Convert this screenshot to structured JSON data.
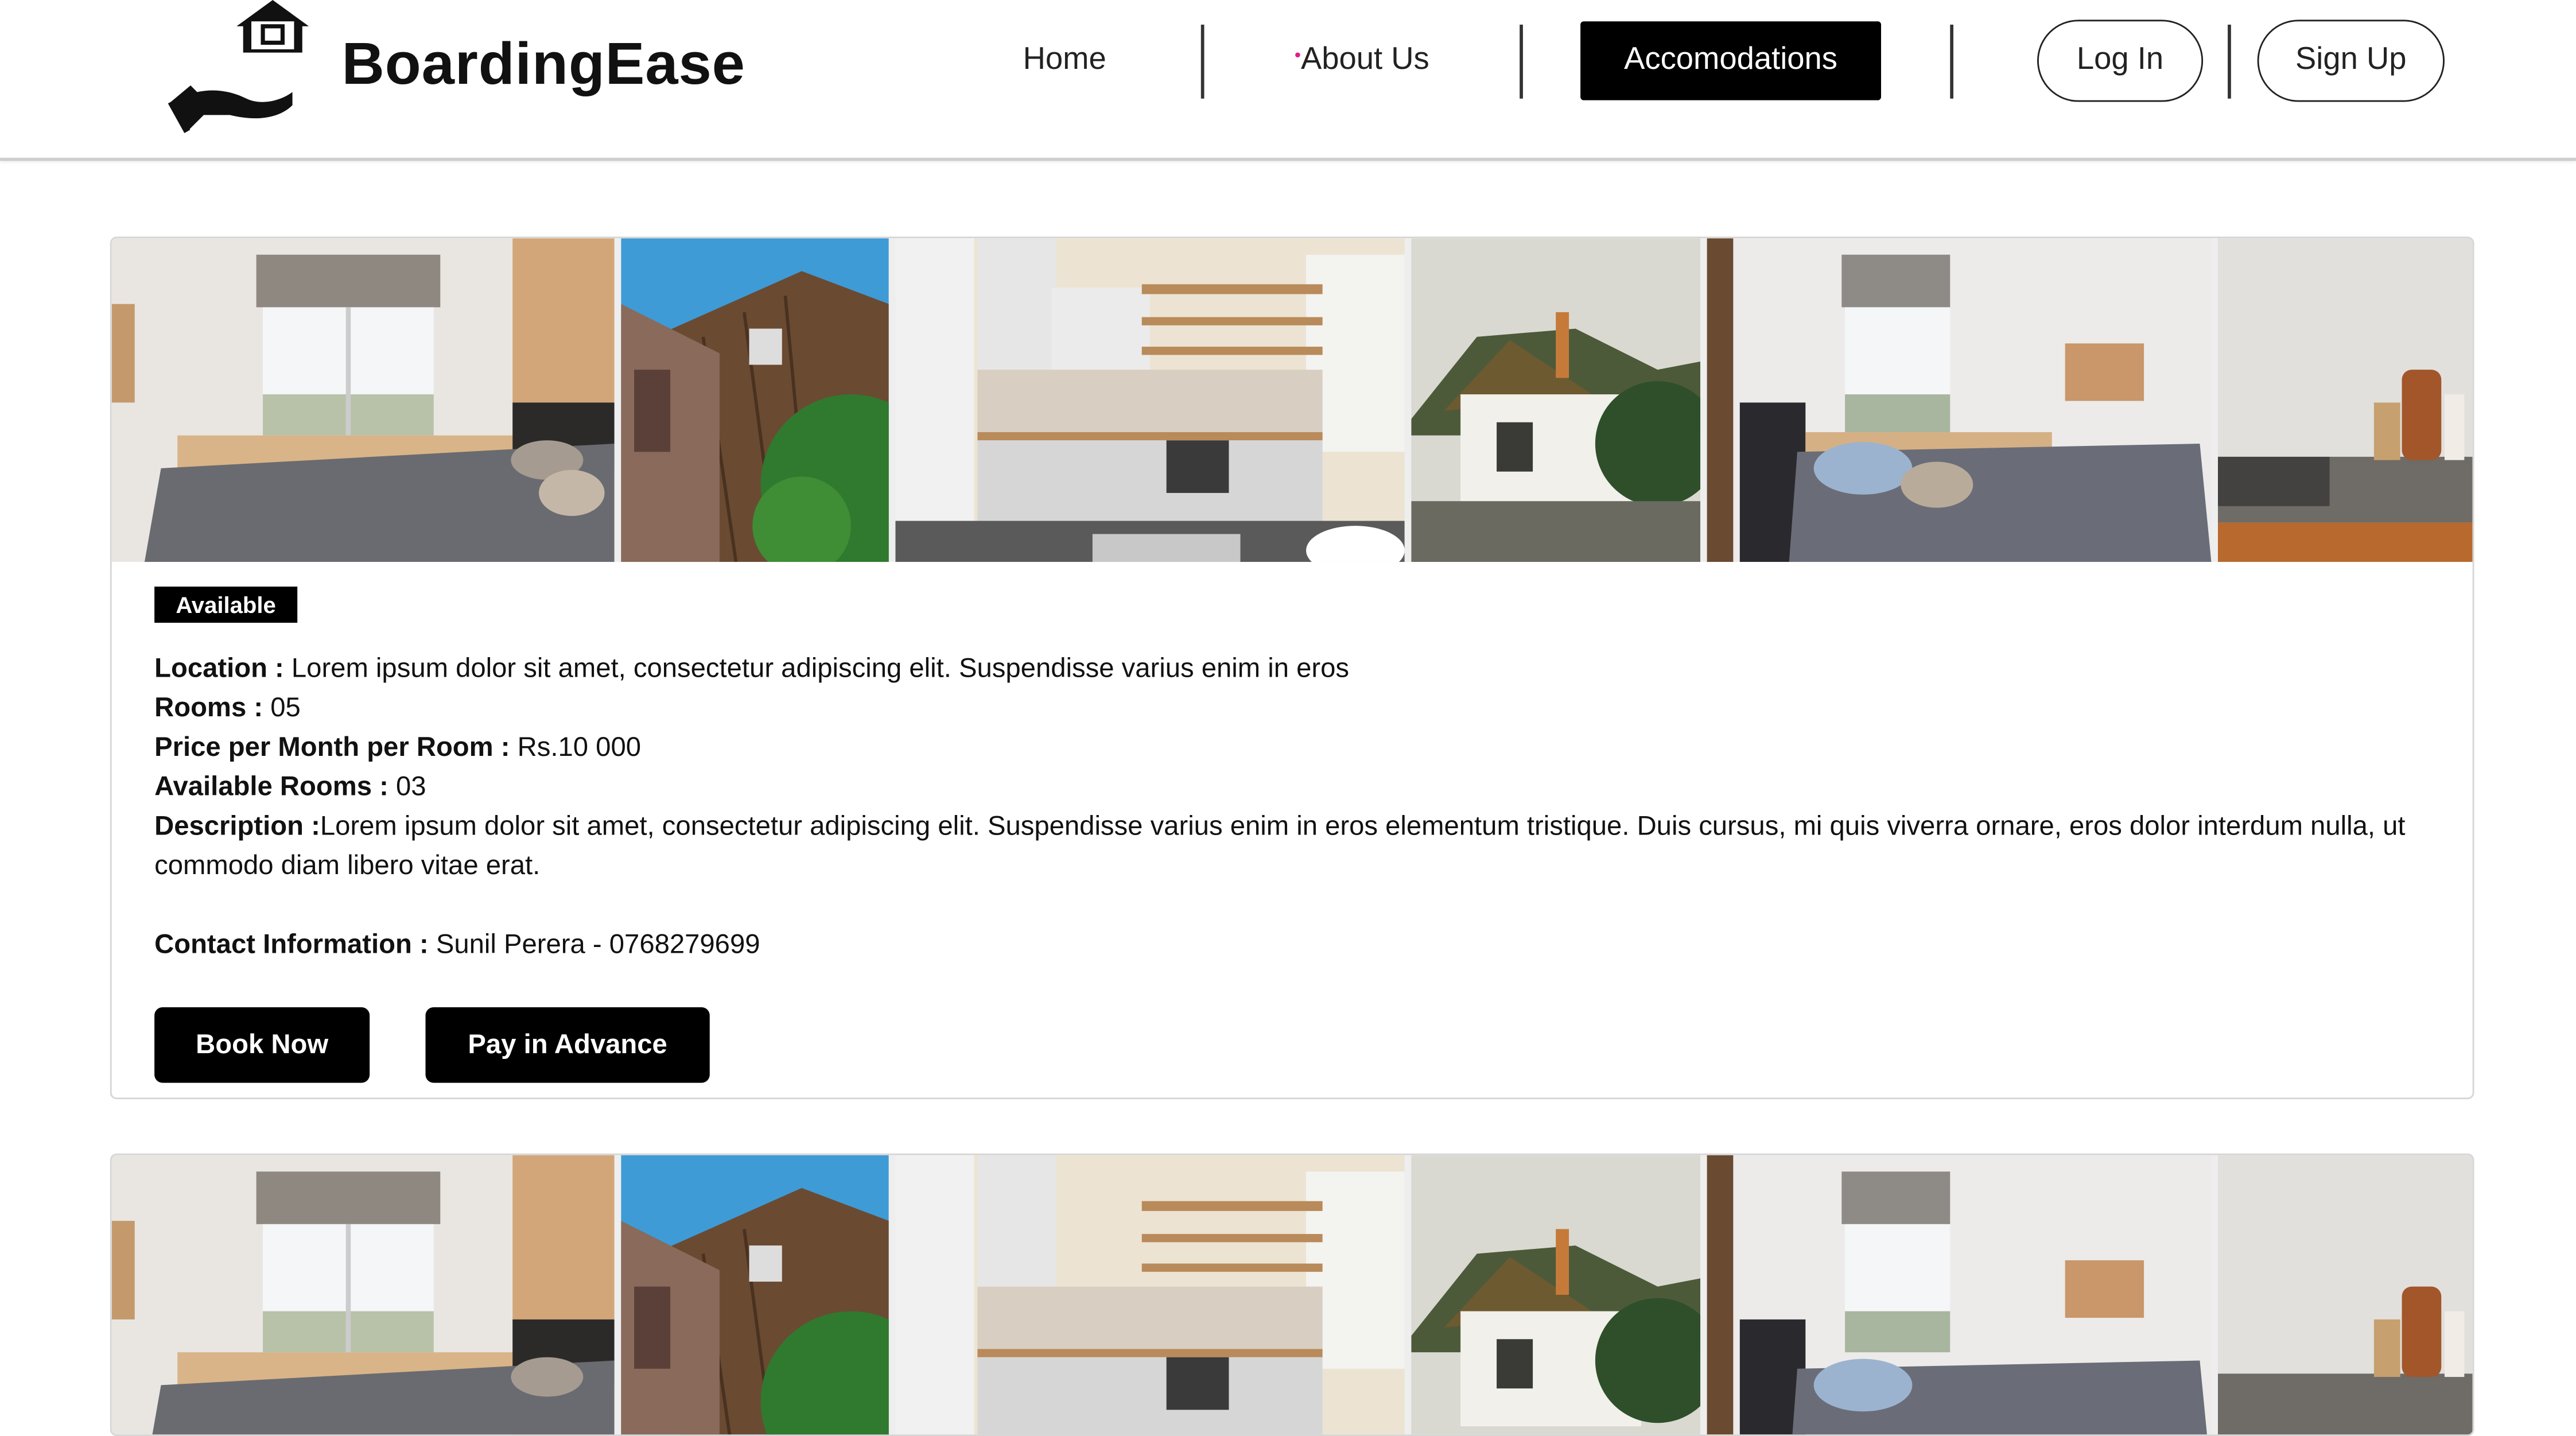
{
  "brand": {
    "name": "BoardingEase"
  },
  "nav": {
    "home": "Home",
    "about": "About Us",
    "accomodations": "Accomodations",
    "login": "Log In",
    "signup": "Sign Up"
  },
  "listings": [
    {
      "status": "Available",
      "location_label": "Location :",
      "location": " Lorem ipsum dolor sit amet, consectetur adipiscing elit. Suspendisse varius enim in eros",
      "rooms_label": "Rooms :",
      "rooms": " 05",
      "price_label": "Price per Month per Room :",
      "price": " Rs.10 000",
      "available_label": "Available Rooms :",
      "available": " 03",
      "description_label": "Description :",
      "description": "Lorem ipsum dolor sit amet, consectetur adipiscing elit. Suspendisse varius enim in eros elementum tristique. Duis cursus, mi quis viverra ornare, eros dolor interdum nulla, ut commodo diam libero vitae erat.",
      "contact_label": "Contact Information :",
      "contact": " Sunil Perera - 0768279699",
      "book_label": "Book Now",
      "pay_label": "Pay in Advance"
    }
  ],
  "colors": {
    "primary": "#000000",
    "accent_dot": "#e11d8a",
    "border": "#d6d6d6"
  },
  "icons": [
    "hand-house-logo-icon"
  ]
}
